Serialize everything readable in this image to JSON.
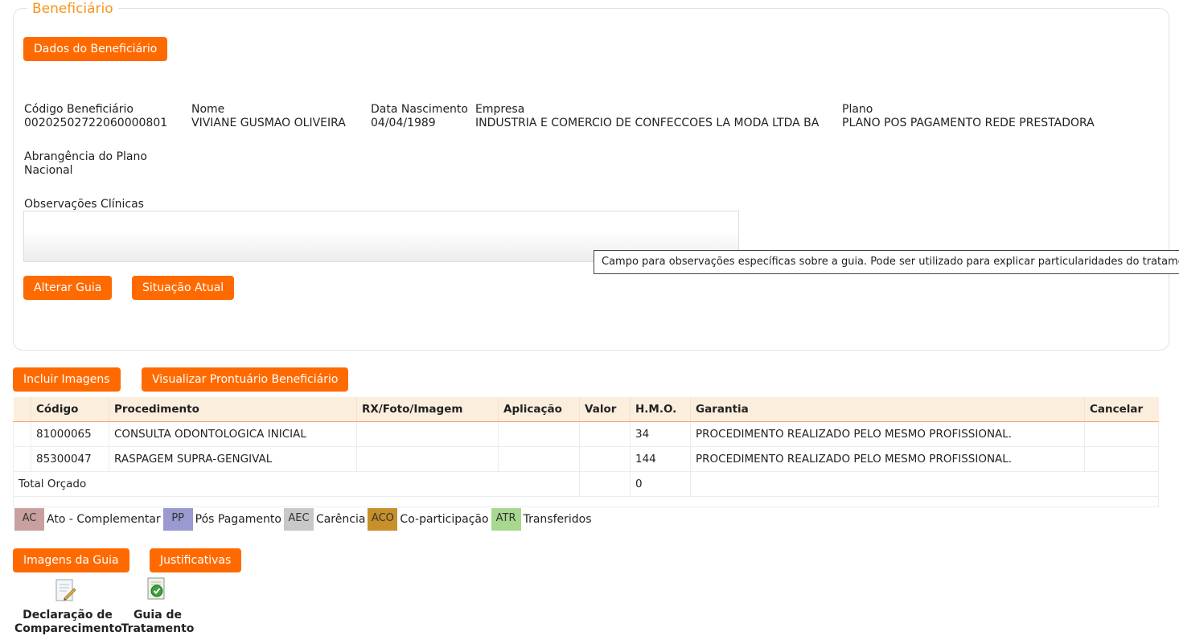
{
  "section": {
    "legend": "Beneficiário",
    "dados_button": "Dados do Beneficiário"
  },
  "beneficiario": {
    "codigo_label": "Código Beneficiário",
    "codigo_value": "00202502722060000801",
    "nome_label": "Nome",
    "nome_value": "VIVIANE GUSMAO OLIVEIRA",
    "nascimento_label": "Data Nascimento",
    "nascimento_value": "04/04/1989",
    "empresa_label": "Empresa",
    "empresa_value": "INDUSTRIA E COMERCIO DE CONFECCOES LA MODA LTDA BA",
    "plano_label": "Plano",
    "plano_value": "PLANO POS PAGAMENTO REDE PRESTADORA",
    "abrangencia_label": "Abrangência do Plano",
    "abrangencia_value": "Nacional",
    "obs_label": "Observações Clínicas",
    "obs_value": ""
  },
  "tooltip": "Campo para observações específicas sobre a guia. Pode ser utilizado para explicar particularidades do tratamento",
  "buttons": {
    "alterar_guia": "Alterar Guia",
    "situacao_atual": "Situação Atual",
    "incluir_imagens": "Incluir Imagens",
    "visualizar_prontuario": "Visualizar Prontuário Beneficiário",
    "imagens_guia": "Imagens da Guia",
    "justificativas": "Justificativas"
  },
  "table": {
    "headers": [
      "",
      "Código",
      "Procedimento",
      "RX/Foto/Imagem",
      "Aplicação",
      "Valor",
      "H.M.O.",
      "Garantia",
      "Cancelar"
    ],
    "rows": [
      {
        "codigo": "81000065",
        "procedimento": "CONSULTA ODONTOLOGICA INICIAL",
        "rx": "",
        "aplicacao": "",
        "valor": "",
        "hmo": "34",
        "garantia": "PROCEDIMENTO REALIZADO PELO MESMO PROFISSIONAL.",
        "cancelar": ""
      },
      {
        "codigo": "85300047",
        "procedimento": "RASPAGEM SUPRA-GENGIVAL",
        "rx": "",
        "aplicacao": "",
        "valor": "",
        "hmo": "144",
        "garantia": "PROCEDIMENTO REALIZADO PELO MESMO PROFISSIONAL.",
        "cancelar": ""
      }
    ],
    "total_label": "Total Orçado",
    "total_valor": "",
    "total_hmo": "0"
  },
  "legend_items": [
    {
      "code": "AC",
      "label": "Ato - Complementar",
      "color": "#c8a0a0"
    },
    {
      "code": "PP",
      "label": "Pós Pagamento",
      "color": "#9a9ad0"
    },
    {
      "code": "AEC",
      "label": "Carência",
      "color": "#c8c8c8"
    },
    {
      "code": "ACO",
      "label": "Co-participação",
      "color": "#c8902a"
    },
    {
      "code": "ATR",
      "label": "Transferidos",
      "color": "#a8d890"
    }
  ],
  "documents": {
    "declaracao_line1": "Declaração de",
    "declaracao_line2": "Comparecimento",
    "guia_line1": "Guia de",
    "guia_line2": "Tratamento"
  }
}
